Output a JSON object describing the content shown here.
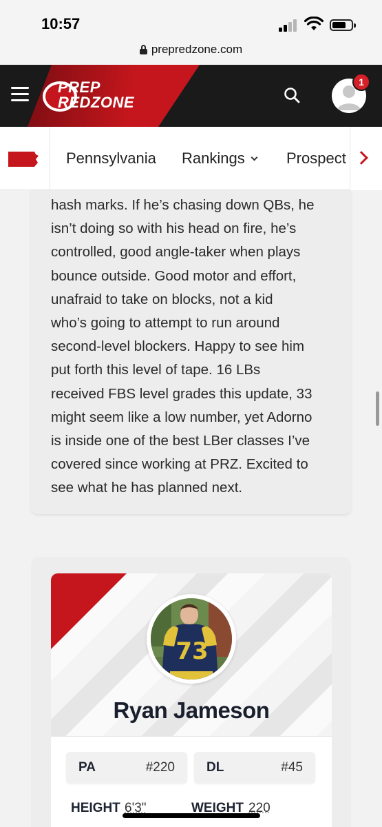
{
  "status_bar": {
    "time": "10:57"
  },
  "browser": {
    "url": "prepredzone.com"
  },
  "header": {
    "logo_line1": "PREP",
    "logo_line2": "REDZONE",
    "notification_count": "1",
    "brand_color": "#c4161c"
  },
  "nav": {
    "items": [
      {
        "label": "Pennsylvania"
      },
      {
        "label": "Rankings"
      },
      {
        "label": "Prospect"
      }
    ]
  },
  "article": {
    "lines": [
      "hash marks. If he’s chasing down QBs, he",
      "isn’t doing so with his head on fire, he’s",
      "controlled, good angle-taker when plays",
      "bounce outside. Good motor and effort,",
      "unafraid to take on blocks, not a kid",
      "who’s going to attempt to run around",
      "second-level blockers. Happy to see him",
      "put forth this level of tape. 16 LBs",
      "received FBS level grades this update, 33",
      "might seem like a low number, yet Adorno",
      "is inside one of the best LBer classes I’ve",
      "covered since working at PRZ. Excited to",
      "see what he has planned next."
    ]
  },
  "player": {
    "name": "Ryan Jameson",
    "jersey_number": "73",
    "state_label": "PA",
    "state_rank": "#220",
    "position_label": "DL",
    "position_rank": "#45",
    "height_label": "HEIGHT",
    "height_value": "6'3\"",
    "weight_label": "WEIGHT",
    "weight_value": "220"
  }
}
